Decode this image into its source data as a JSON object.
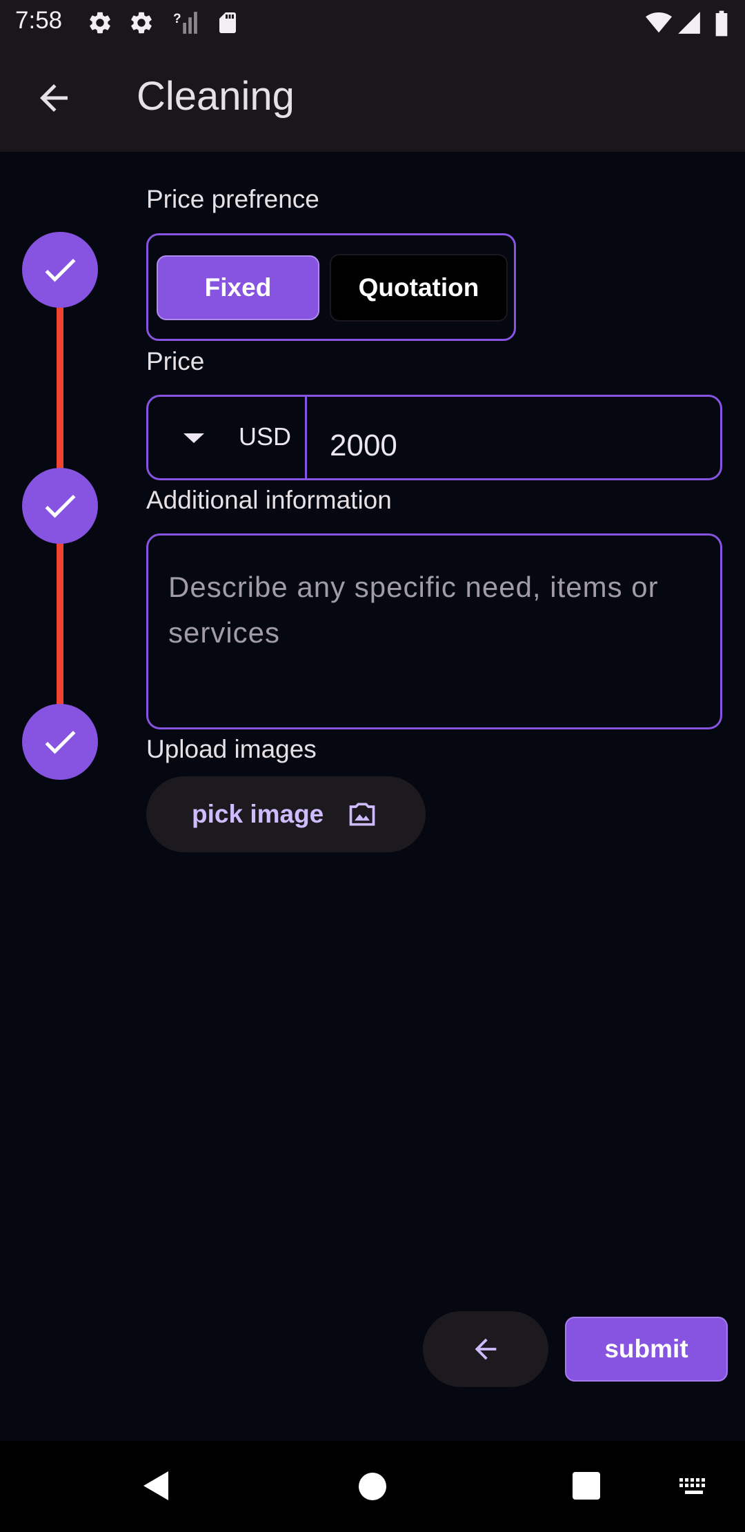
{
  "status_bar": {
    "time": "7:58",
    "icons": [
      "settings-icon",
      "settings-icon",
      "no-signal-icon",
      "sd-card-icon",
      "wifi-icon",
      "cell-signal-icon",
      "battery-icon"
    ]
  },
  "app_bar": {
    "title": "Cleaning",
    "back_icon": "arrow-back-icon"
  },
  "stepper": {
    "steps_completed": 3,
    "line_color": "#f04433",
    "circle_color": "#8654e0",
    "icon": "check-icon"
  },
  "price_preference": {
    "label": "Price prefrence",
    "options": [
      "Fixed",
      "Quotation"
    ],
    "selected": "Fixed"
  },
  "price": {
    "label": "Price",
    "currency": "USD",
    "value": "2000",
    "dropdown_icon": "arrow-drop-down-icon"
  },
  "additional_info": {
    "label": "Additional information",
    "placeholder": "Describe any specific need, items or services",
    "value": ""
  },
  "upload": {
    "label": "Upload images",
    "button_label": "pick image",
    "icon": "image-icon"
  },
  "actions": {
    "back_icon": "arrow-back-icon",
    "submit_label": "submit"
  },
  "colors": {
    "accent": "#8654e0",
    "background": "#050811",
    "app_bar": "#1a171b",
    "step_line": "#f04433",
    "tonal_button": "#1c1a1f",
    "tonal_text": "#cfbcff"
  },
  "nav_bar": {
    "icons": [
      "back-triangle-icon",
      "home-circle-icon",
      "recents-square-icon",
      "keyboard-icon"
    ]
  }
}
